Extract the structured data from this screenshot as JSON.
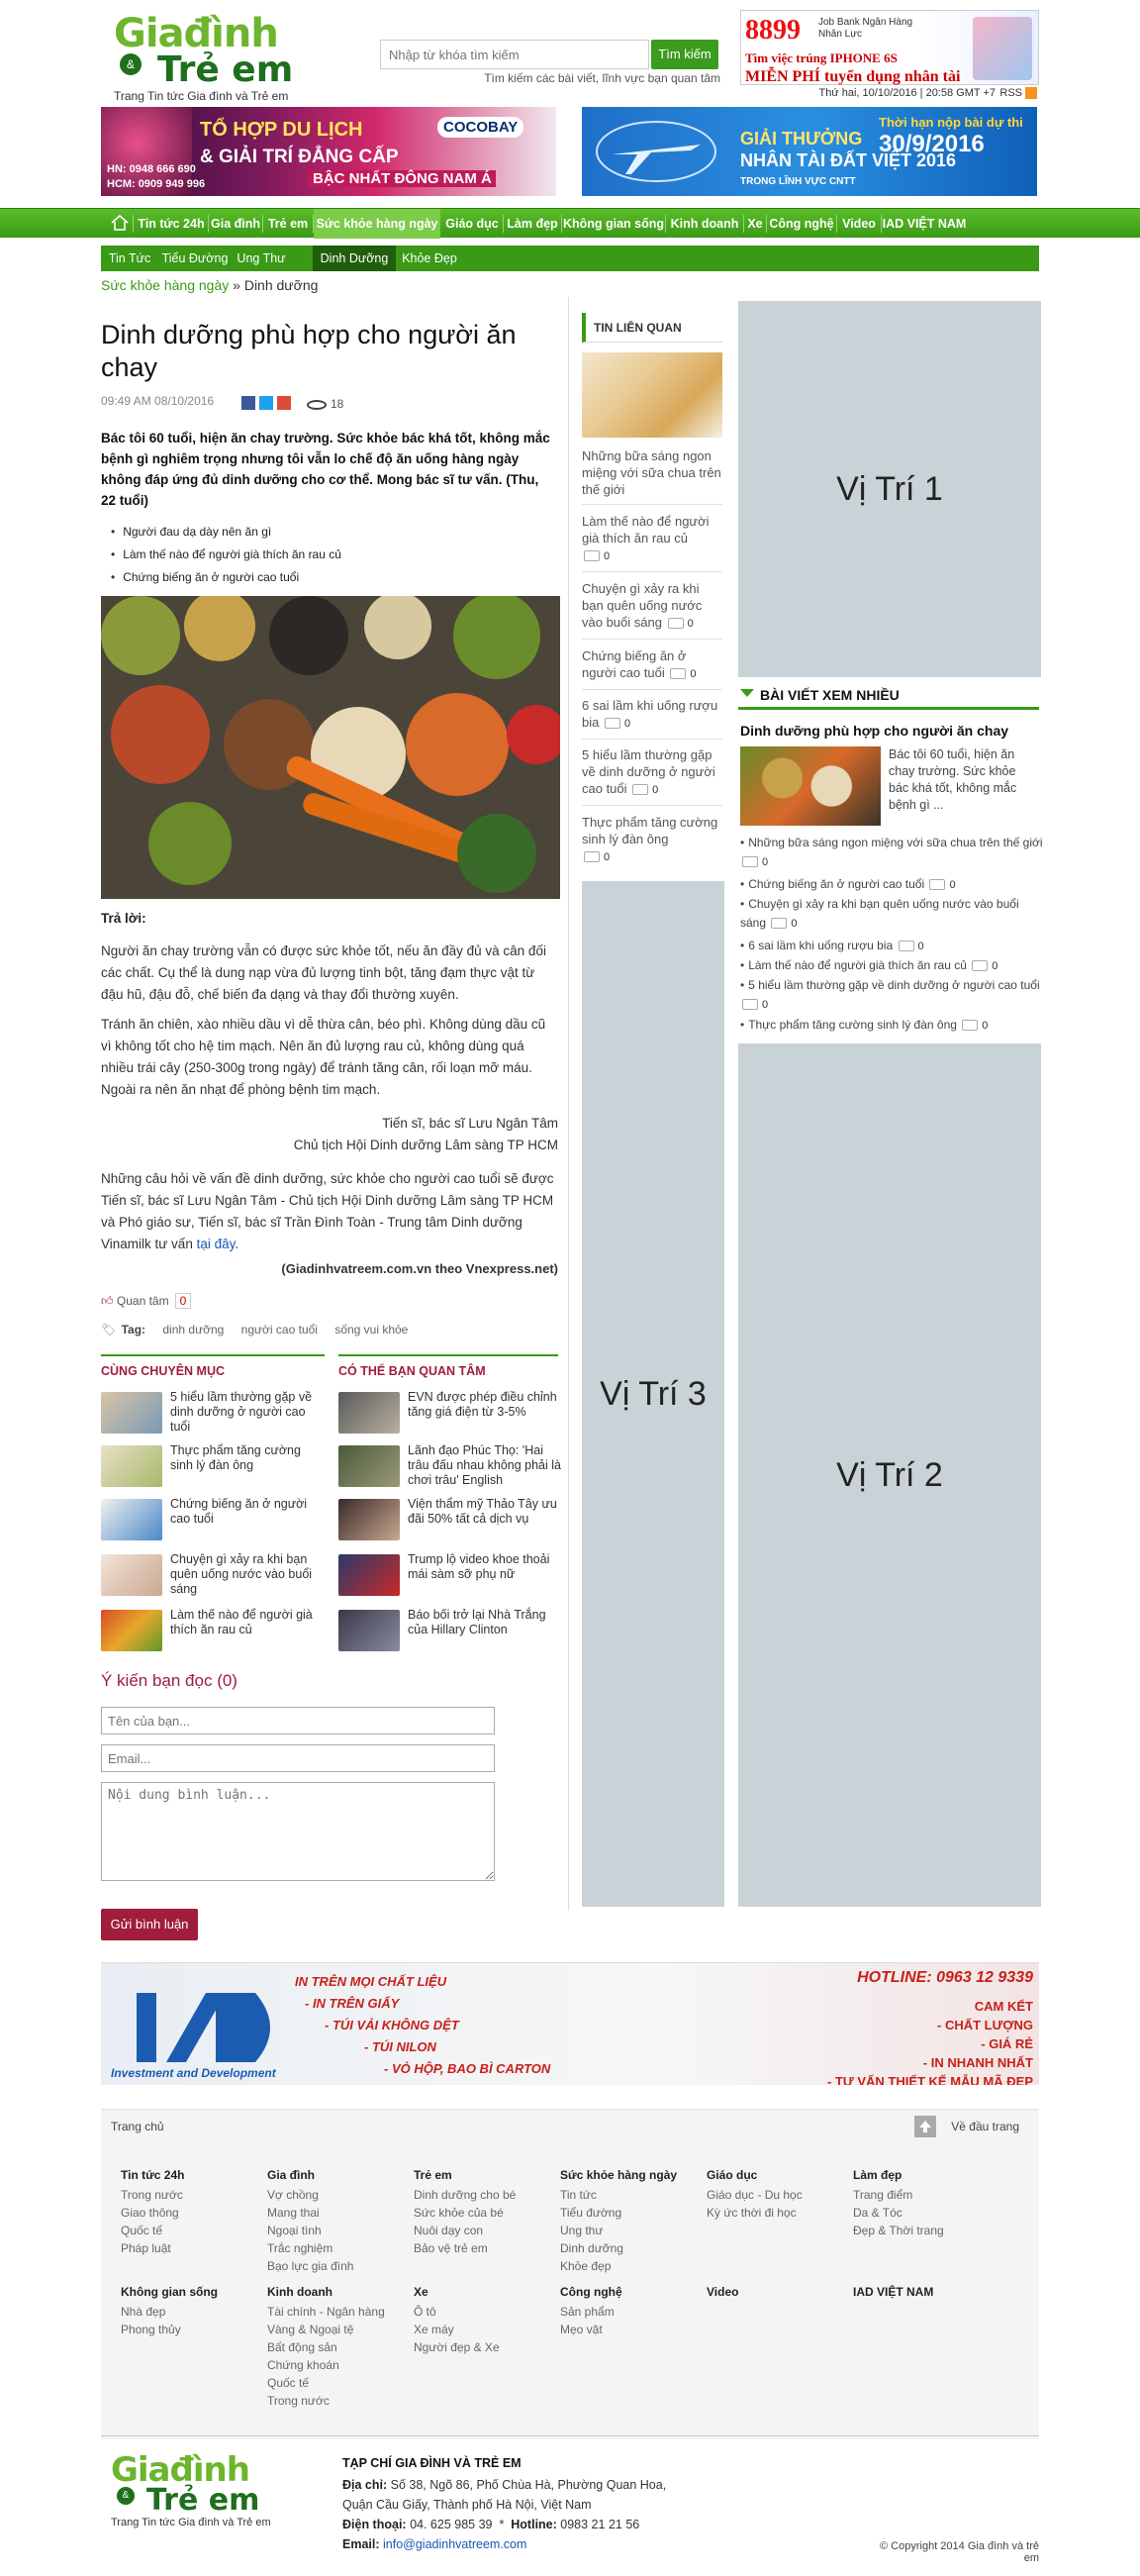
{
  "header": {
    "logo_top": "Giađình",
    "logo_amp": "&",
    "logo_bottom": "Trẻ em",
    "tagline": "Trang Tin tức Gia đình và Trẻ em",
    "search_placeholder": "Nhập từ khóa tìm kiếm",
    "search_button": "Tìm kiếm",
    "search_hint": "Tìm kiếm các bài viết, lĩnh vực bạn quan tâm",
    "top_ad": {
      "number": "8899",
      "line1": "Tìm việc trúng IPHONE 6S",
      "line2": "MIỄN PHÍ tuyển dụng nhân tài",
      "small": "Job Bank Ngân Hàng Nhân Lực"
    },
    "datetime": "Thứ hai, 10/10/2016 | 20:58 GMT +7",
    "rss": "RSS",
    "banner_left": {
      "t1": "TỔ HỢP DU LỊCH",
      "t2": "& GIẢI TRÍ ĐẲNG CẤP",
      "t3": "BẬC NHẤT ĐÔNG NAM Á",
      "phone1": "HN: 0948 666 690",
      "phone2": "HCM: 0909 949 996",
      "brand": "COCOBAY"
    },
    "banner_right": {
      "t1": "GIẢI THƯỞNG",
      "t2": "NHÂN TÀI ĐẤT VIỆT 2016",
      "deadline_label": "Thời hạn nộp bài dự thi",
      "deadline": "30/9/2016",
      "sub": "TRONG LĨNH VỰC CNTT"
    }
  },
  "nav": {
    "items": [
      "Tin tức 24h",
      "Gia đình",
      "Trẻ em",
      "Sức khỏe hàng ngày",
      "Giáo dục",
      "Làm đẹp",
      "Không gian sống",
      "Kinh doanh",
      "Xe",
      "Công nghệ",
      "Video",
      "IAD VIỆT NAM"
    ],
    "subitems": [
      "Tin Tức",
      "Tiểu Đường",
      "Ung Thư",
      "Dinh Dưỡng",
      "Khỏe Đẹp"
    ]
  },
  "breadcrumb": {
    "parent": "Sức khỏe hàng ngày",
    "sep": "»",
    "current": "Dinh dưỡng"
  },
  "article": {
    "title": "Dinh dưỡng phù hợp cho người ăn chay",
    "meta": "09:49 AM 08/10/2016",
    "views": "18",
    "lead": "Bác tôi 60 tuổi, hiện ăn chay trường. Sức khỏe bác khá tốt, không mắc bệnh gì nghiêm trọng nhưng tôi vẫn lo chế độ ăn uống hàng ngày không đáp ứng đủ dinh dưỡng cho cơ thể. Mong bác sĩ tư vấn. (Thu, 22 tuổi)",
    "bullets": [
      "Người đau dạ dày nên ăn gì",
      "Làm thế nào để người già thích ăn rau củ",
      "Chứng biếng ăn ở người cao tuổi"
    ],
    "answer_heading": "Trả lời:",
    "p1": "Người ăn chay trường vẫn có được sức khỏe tốt, nếu ăn đầy đủ và cân đối các chất. Cụ thể là dung nạp vừa đủ lượng tinh bột, tăng đạm thực vật từ đậu hũ, đậu đỗ, chế biến đa dạng và thay đổi thường xuyên.",
    "p2": "Tránh ăn chiên, xào nhiều dầu vì dễ thừa cân, béo phì. Không dùng dầu cũ vì không tốt cho hệ tim mạch. Nên ăn đủ lượng rau củ, không dùng quá nhiều trái cây (250-300g trong ngày) để tránh tăng cân, rối loạn mỡ máu. Ngoài ra nên ăn nhạt để phòng bệnh tim mạch.",
    "sig1": "Tiến sĩ, bác sĩ Lưu Ngân Tâm",
    "sig2": "Chủ tịch Hội Dinh dưỡng Lâm sàng TP HCM",
    "p3": "Những câu hỏi về vấn đề dinh dưỡng, sức khỏe cho người cao tuổi sẽ được Tiến sĩ, bác sĩ Lưu Ngân Tâm - Chủ tịch Hội Dinh dưỡng Lâm sàng TP HCM và Phó giáo sư, Tiến sĩ, bác sĩ Trần Đình Toàn - Trung tâm Dinh dưỡng Vinamilk tư vấn",
    "p3_link": "tại đây",
    "source": "(Giadinhvatreem.com.vn theo Vnexpress.net)",
    "like_label": "Quan tâm",
    "like_count": "0",
    "tags_label": "Tag:",
    "tags": [
      "dinh dưỡng",
      "người cao tuổi",
      "sống vui khỏe"
    ]
  },
  "same_category": {
    "heading": "CÙNG CHUYÊN MỤC",
    "items": [
      "5 hiểu lầm thường gặp về dinh dưỡng ở người cao tuổi",
      "Thực phẩm tăng cường sinh lý đàn ông",
      "Chứng biếng ăn ở người cao tuổi",
      "Chuyện gì xảy ra khi bạn quên uống nước vào buổi sáng",
      "Làm thế nào để người già thích ăn rau củ"
    ]
  },
  "maybe_interested": {
    "heading": "CÓ THỂ BẠN QUAN TÂM",
    "items": [
      "EVN được phép điều chỉnh tăng giá điện từ 3-5%",
      "Lãnh đạo Phúc Thọ: 'Hai trâu đấu nhau không phải là chơi trâu' English",
      "Viện thẩm mỹ Thảo Tây ưu đãi 50% tất cả dịch vụ",
      "Trump lộ video khoe thoải mái sàm sỡ phụ nữ",
      "Báo bối trở lại Nhà Trắng của Hillary Clinton"
    ]
  },
  "comments": {
    "heading": "Ý kiến bạn đọc (0)",
    "name_placeholder": "Tên của bạn...",
    "email_placeholder": "Email...",
    "content_placeholder": "Nội dung bình luận...",
    "send": "Gửi bình luận"
  },
  "related": {
    "heading": "TIN LIÊN QUAN",
    "items": [
      {
        "text": "Những bữa sáng ngon miệng với sữa chua trên thế giới",
        "count": ""
      },
      {
        "text": "Làm thế nào để người già thích ăn rau củ",
        "count": "0"
      },
      {
        "text": "Chuyện gì xảy ra khi bạn quên uống nước vào buổi sáng",
        "count": "0"
      },
      {
        "text": "Chứng biếng ăn ở người cao tuổi",
        "count": "0"
      },
      {
        "text": "6 sai lầm khi uống rượu bia",
        "count": "0"
      },
      {
        "text": "5 hiểu lầm thường gặp về dinh dưỡng ở người cao tuổi",
        "count": "0"
      },
      {
        "text": "Thực phẩm tăng cường sinh lý đàn ông",
        "count": "0"
      }
    ]
  },
  "ads": {
    "pos1": "Vị Trí 1",
    "pos2": "Vị Trí 2",
    "pos3": "Vị Trí 3"
  },
  "most_viewed": {
    "heading": "BÀI VIẾT XEM NHIỀU",
    "top_title": "Dinh dưỡng phù hợp cho người ăn chay",
    "top_desc": "Bác tôi 60 tuổi, hiện ăn chay trường. Sức khỏe bác khá tốt, không mắc bệnh gì ...",
    "items": [
      {
        "text": "Những bữa sáng ngon miệng với sữa chua trên thế giới",
        "count": "0"
      },
      {
        "text": "Chứng biếng ăn ở người cao tuổi",
        "count": "0"
      },
      {
        "text": "Chuyện gì xảy ra khi bạn quên uống nước vào buổi sáng",
        "count": "0"
      },
      {
        "text": "6 sai lầm khi uống rượu bia",
        "count": "0"
      },
      {
        "text": "Làm thế nào để người già thích ăn rau củ",
        "count": "0"
      },
      {
        "text": "5 hiểu lầm thường gặp về dinh dưỡng ở người cao tuổi",
        "count": "0"
      },
      {
        "text": "Thực phẩm tăng cường sinh lý đàn ông",
        "count": "0"
      }
    ]
  },
  "footer_ad": {
    "line1": "IN TRÊN MỌI CHẤT LIỆU",
    "line2": "- IN TRÊN GIẤY",
    "line3": "- TÚI VẢI KHÔNG DỆT",
    "line4": "- TÚI NILON",
    "line5": "- VỎ HỘP, BAO BÌ CARTON",
    "hotline": "HOTLINE: 0963 12 9339",
    "r1": "CAM KẾT",
    "r2": "- GIÁ RẺ",
    "r3": "- IN NHANH NHẤT",
    "r4": "- TƯ VẤN THIẾT KẾ MẪU MÃ ĐẸP",
    "brand": "Investment and Development",
    "r0": "- CHẤT LƯỢNG"
  },
  "footer": {
    "home": "Trang chủ",
    "top": "Về đầu trang",
    "cols": [
      {
        "h": "Tin tức 24h",
        "items": [
          "Trong nước",
          "Giao thông",
          "Quốc tế",
          "Pháp luật"
        ]
      },
      {
        "h": "Gia đình",
        "items": [
          "Vợ chồng",
          "Mang thai",
          "Ngoại tình",
          "Trắc nghiệm",
          "Bạo lực gia đình"
        ]
      },
      {
        "h": "Trẻ em",
        "items": [
          "Dinh dưỡng cho bé",
          "Sức khỏe của bé",
          "Nuôi dạy con",
          "Bảo vệ trẻ em"
        ]
      },
      {
        "h": "Sức khỏe hàng ngày",
        "items": [
          "Tin tức",
          "Tiểu đường",
          "Ung thư",
          "Dinh dưỡng",
          "Khỏe đẹp"
        ]
      },
      {
        "h": "Giáo dục",
        "items": [
          "Giáo dục - Du học",
          "Kỳ ức thời đi học"
        ]
      },
      {
        "h": "Làm đẹp",
        "items": [
          "Trang điểm",
          "Da & Tóc",
          "Đẹp & Thời trang"
        ]
      },
      {
        "h": "Không gian sống",
        "items": [
          "Nhà đẹp",
          "Phong thủy"
        ]
      },
      {
        "h": "Kinh doanh",
        "items": [
          "Tài chính - Ngân hàng",
          "Vàng & Ngoại tệ",
          "Bất động sản",
          "Chứng khoán",
          "Quốc tế",
          "Trong nước"
        ]
      },
      {
        "h": "Xe",
        "items": [
          "Ô tô",
          "Xe máy",
          "Người đẹp & Xe"
        ]
      },
      {
        "h": "Công nghệ",
        "items": [
          "Sản phẩm",
          "Mẹo vặt"
        ]
      },
      {
        "h": "Video",
        "items": []
      },
      {
        "h": "IAD VIỆT NAM",
        "items": []
      }
    ],
    "mag_title": "TẠP CHÍ GIA ĐÌNH VÀ TRẺ EM",
    "addr_label": "Địa chỉ:",
    "addr": "Số 38, Ngõ 86, Phố Chùa Hà, Phường Quan Hoa, Quận Cầu Giấy, Thành phố Hà Nội, Việt Nam",
    "phone_label": "Điện thoại:",
    "phone": "04. 625 985 39",
    "hotline_label": "Hotline:",
    "hotline": "0983 21 21 56",
    "email_label": "Email:",
    "email": "info@giadinhvatreem.com",
    "copyright": "© Copyright 2014 Gia đình và trẻ em",
    "tagline": "Trang Tin tức Gia đình và Trẻ em"
  },
  "colors": {
    "green": "#3a9a16",
    "crimson": "#a01d3b",
    "ad_gray": "#c9d3d7"
  }
}
